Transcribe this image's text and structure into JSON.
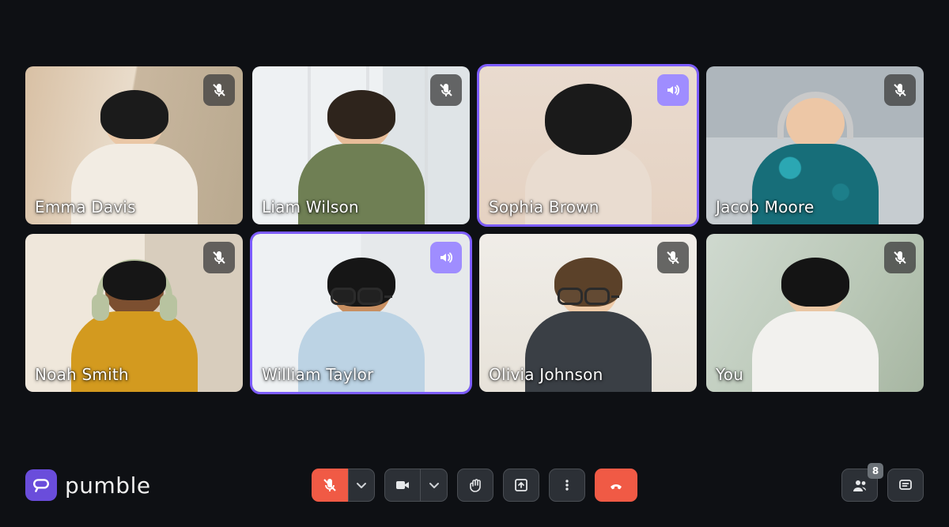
{
  "app": {
    "name": "pumble",
    "colors": {
      "accent": "#7c5cff",
      "danger": "#f05a45",
      "background": "#0e1014"
    }
  },
  "participants": [
    {
      "name": "Emma Davis",
      "status": "muted",
      "speaking": false
    },
    {
      "name": "Liam Wilson",
      "status": "muted",
      "speaking": false
    },
    {
      "name": "Sophia Brown",
      "status": "speaking",
      "speaking": true
    },
    {
      "name": "Jacob Moore",
      "status": "muted",
      "speaking": false
    },
    {
      "name": "Noah Smith",
      "status": "muted",
      "speaking": false
    },
    {
      "name": "William Taylor",
      "status": "speaking",
      "speaking": true
    },
    {
      "name": "Olivia Johnson",
      "status": "muted",
      "speaking": false
    },
    {
      "name": "You",
      "status": "muted",
      "speaking": false
    }
  ],
  "controls": {
    "mic_icon": "mic-off-icon",
    "camera_icon": "camera-icon",
    "raise_hand_icon": "raise-hand-icon",
    "share_icon": "share-screen-icon",
    "more_icon": "more-icon",
    "leave_icon": "hang-up-icon",
    "people_icon": "people-icon",
    "chat_icon": "chat-icon",
    "participant_count": "8"
  }
}
